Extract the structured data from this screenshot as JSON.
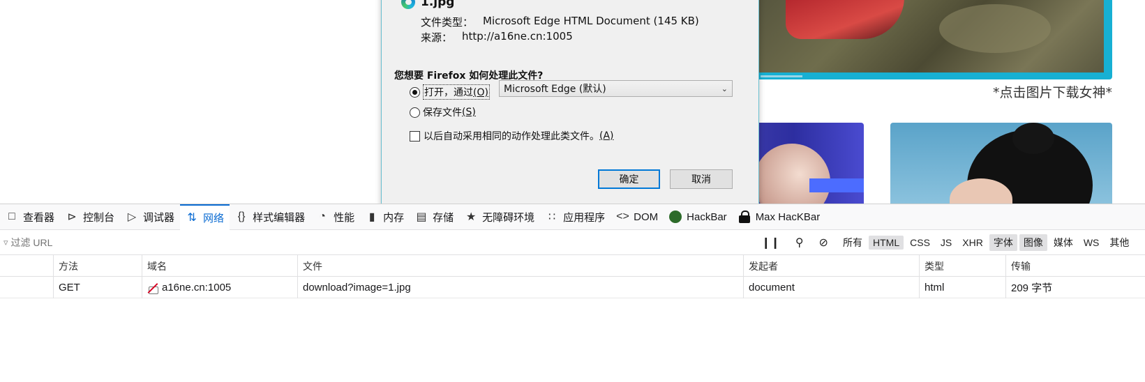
{
  "webpage": {
    "caption": "*点击图片下载女神*"
  },
  "dialog": {
    "filename": "1.jpg",
    "type_label": "文件类型：",
    "type_value": "Microsoft Edge HTML Document (145 KB)",
    "source_label": "来源：",
    "source_value": "http://a16ne.cn:1005",
    "question": "您想要 Firefox 如何处理此文件?",
    "open_with_label": "打开，通过",
    "open_with_key": "(O)",
    "open_with_app": "Microsoft Edge (默认)",
    "save_label": "保存文件",
    "save_key": "(S)",
    "auto_label": "以后自动采用相同的动作处理此类文件。",
    "auto_key": "(A)",
    "ok_button": "确定",
    "cancel_button": "取消"
  },
  "devtools": {
    "tabs": [
      {
        "label": "查看器",
        "icon": "inspector-icon"
      },
      {
        "label": "控制台",
        "icon": "console-icon"
      },
      {
        "label": "调试器",
        "icon": "debugger-icon"
      },
      {
        "label": "网络",
        "icon": "network-icon",
        "active": true
      },
      {
        "label": "样式编辑器",
        "icon": "braces-icon"
      },
      {
        "label": "性能",
        "icon": "gauge-icon"
      },
      {
        "label": "内存",
        "icon": "memory-icon"
      },
      {
        "label": "存储",
        "icon": "storage-icon"
      },
      {
        "label": "无障碍环境",
        "icon": "accessibility-icon"
      },
      {
        "label": "应用程序",
        "icon": "grid-icon"
      },
      {
        "label": "DOM",
        "icon": "dom-icon"
      },
      {
        "label": "HackBar",
        "icon": "hackbar-icon"
      },
      {
        "label": "Max HacKBar",
        "icon": "lock-icon"
      }
    ],
    "filter_placeholder": "过滤 URL",
    "type_filters": [
      {
        "label": "所有",
        "on": false
      },
      {
        "label": "HTML",
        "on": true
      },
      {
        "label": "CSS",
        "on": false
      },
      {
        "label": "JS",
        "on": false
      },
      {
        "label": "XHR",
        "on": false
      },
      {
        "label": "字体",
        "on": true
      },
      {
        "label": "图像",
        "on": true
      },
      {
        "label": "媒体",
        "on": false
      },
      {
        "label": "WS",
        "on": false
      },
      {
        "label": "其他",
        "on": false
      }
    ],
    "columns": {
      "method": "方法",
      "domain": "域名",
      "file": "文件",
      "initiator": "发起者",
      "type": "类型",
      "transferred": "传输"
    },
    "rows": [
      {
        "method": "GET",
        "domain": "a16ne.cn:1005",
        "file": "download?image=1.jpg",
        "initiator": "document",
        "type": "html",
        "transferred": "209 字节"
      }
    ]
  }
}
